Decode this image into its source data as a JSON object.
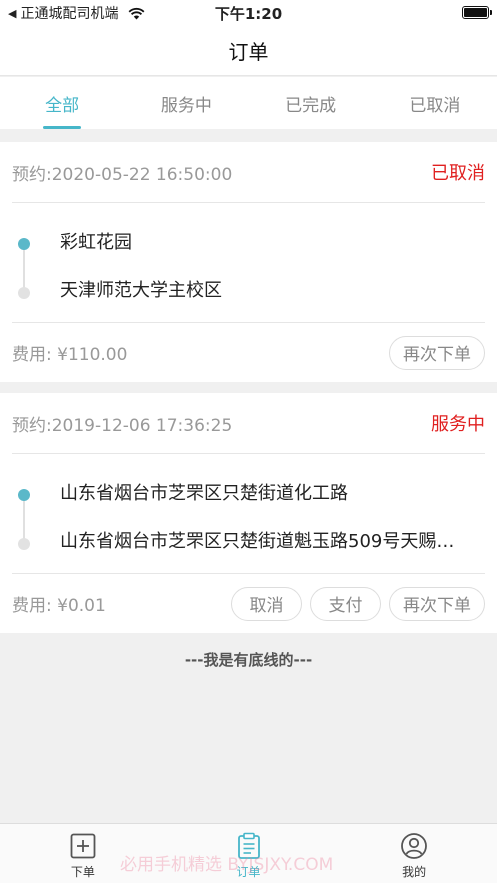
{
  "status_bar": {
    "back_app": "正通城配司机端",
    "time": "下午1:20",
    "battery_level": 1.0
  },
  "nav": {
    "title": "订单"
  },
  "tabs": [
    {
      "label": "全部",
      "active": true
    },
    {
      "label": "服务中",
      "active": false
    },
    {
      "label": "已完成",
      "active": false
    },
    {
      "label": "已取消",
      "active": false
    }
  ],
  "orders": [
    {
      "booking": "预约:2020-05-22 16:50:00",
      "status": "已取消",
      "from": "彩虹花园",
      "to": "天津师范大学主校区",
      "fee": "费用: ¥110.00",
      "buttons": {
        "reorder": "再次下单"
      }
    },
    {
      "booking": "预约:2019-12-06 17:36:25",
      "status": "服务中",
      "from": "山东省烟台市芝罘区只楚街道化工路",
      "to": "山东省烟台市芝罘区只楚街道魁玉路509号天赐…",
      "fee": "费用: ¥0.01",
      "buttons": {
        "cancel": "取消",
        "pay": "支付",
        "reorder": "再次下单"
      }
    }
  ],
  "footer_note": "---我是有底线的---",
  "tabbar": [
    {
      "label": "下单",
      "icon": "plus-square-icon",
      "active": false
    },
    {
      "label": "订单",
      "icon": "clipboard-icon",
      "active": true
    },
    {
      "label": "我的",
      "icon": "user-circle-icon",
      "active": false
    }
  ],
  "watermark": "必用手机精选 BYJSJXY.COM",
  "colors": {
    "accent": "#46b6c9",
    "status_red": "#e02020"
  }
}
